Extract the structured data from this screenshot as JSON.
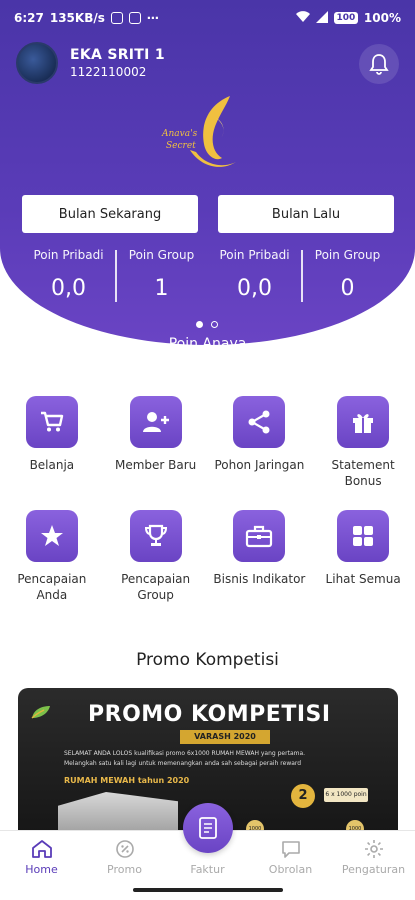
{
  "status_bar": {
    "time": "6:27",
    "speed": "135KB/s",
    "battery": "100",
    "battery_pct": "100%"
  },
  "user": {
    "name": "EKA SRITI 1",
    "id": "1122110002"
  },
  "logo": {
    "line1": "Anava's",
    "line2": "Secret"
  },
  "tabs": [
    {
      "label": "Bulan Sekarang"
    },
    {
      "label": "Bulan Lalu"
    }
  ],
  "points": [
    {
      "label": "Poin Pribadi",
      "value": "0,0"
    },
    {
      "label": "Poin Group",
      "value": "1"
    },
    {
      "label": "Poin Pribadi",
      "value": "0,0"
    },
    {
      "label": "Poin Group",
      "value": "0"
    }
  ],
  "carousel": {
    "caption": "Poin Anava",
    "page": 1,
    "total": 2
  },
  "menu": [
    {
      "label": "Belanja",
      "icon": "cart-icon"
    },
    {
      "label": "Member Baru",
      "icon": "add-user-icon"
    },
    {
      "label": "Pohon Jaringan",
      "icon": "share-icon"
    },
    {
      "label": "Statement Bonus",
      "icon": "gift-icon"
    },
    {
      "label": "Pencapaian Anda",
      "icon": "star-icon"
    },
    {
      "label": "Pencapaian Group",
      "icon": "trophy-icon"
    },
    {
      "label": "Bisnis Indikator",
      "icon": "briefcase-icon"
    },
    {
      "label": "Lihat Semua",
      "icon": "grid-icon"
    }
  ],
  "promo": {
    "section_title": "Promo Kompetisi",
    "banner_title": "PROMO KOMPETISI",
    "banner_sub": "VARASH 2020",
    "line1": "SELAMAT ANDA LOLOS kualifikasi promo 6x1000 RUMAH MEWAH yang pertama.",
    "line2": "Melangkah satu kali lagi untuk memenangkan anda sah sebagai peraih reward",
    "strong": "RUMAH MEWAH tahun 2020",
    "medal": "2",
    "medal_note": "6 x 1000 poin",
    "coin": "1000"
  },
  "bottom_nav": [
    {
      "label": "Home",
      "icon": "home-icon",
      "active": true
    },
    {
      "label": "Promo",
      "icon": "badge-icon",
      "active": false
    },
    {
      "label": "Faktur",
      "icon": "receipt-icon",
      "active": false
    },
    {
      "label": "Obrolan",
      "icon": "chat-icon",
      "active": false
    },
    {
      "label": "Pengaturan",
      "icon": "gear-icon",
      "active": false
    }
  ],
  "colors": {
    "primary": "#5a3cb8",
    "accent": "#8a62de",
    "gold": "#e3b53e"
  }
}
